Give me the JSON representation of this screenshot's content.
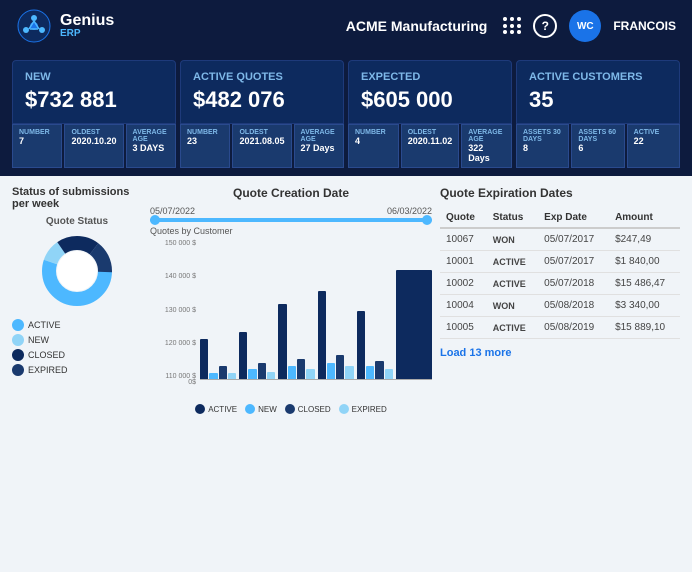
{
  "header": {
    "logo_text": "Genius",
    "logo_sub": "ERP",
    "company": "ACME Manufacturing",
    "user_initials": "WC",
    "user_name": "FRANCOIS",
    "help_label": "?",
    "grid_icon": "grid-icon"
  },
  "kpi_cards": [
    {
      "label": "New",
      "value": "$732 881"
    },
    {
      "label": "Active quotes",
      "value": "$482 076"
    },
    {
      "label": "Expected",
      "value": "$605 000"
    },
    {
      "label": "Active customers",
      "value": "35"
    }
  ],
  "stats": [
    {
      "items": [
        {
          "label": "NUMBER",
          "value": "7"
        },
        {
          "label": "OLDEST",
          "value": "2020.10.20"
        },
        {
          "label": "AVERAGE AGE",
          "value": "3 DAYS"
        }
      ]
    },
    {
      "items": [
        {
          "label": "NUMBER",
          "value": "23"
        },
        {
          "label": "OLDEST",
          "value": "2021.08.05"
        },
        {
          "label": "AVERAGE AGE",
          "value": "27 Days"
        }
      ]
    },
    {
      "items": [
        {
          "label": "NUMBER",
          "value": "4"
        },
        {
          "label": "OLDEST",
          "value": "2020.11.02"
        },
        {
          "label": "AVERAGE AGE",
          "value": "322 Days"
        }
      ]
    },
    {
      "items": [
        {
          "label": "ASSETS 30 days",
          "value": "8"
        },
        {
          "label": "ASSETS 60 days",
          "value": "6"
        },
        {
          "label": "ACTIVE",
          "value": "22"
        }
      ]
    }
  ],
  "status_title": "Status of submissions per week",
  "donut_label": "Quote Status",
  "donut_segments": [
    {
      "label": "ACTIVE",
      "color": "#4db8ff",
      "pct": 55
    },
    {
      "label": "NEW",
      "color": "#90d4f7",
      "pct": 10
    },
    {
      "label": "CLOSED",
      "color": "#0d2a5e",
      "pct": 20
    },
    {
      "label": "EXPIRED",
      "color": "#1a3a6e",
      "pct": 15
    }
  ],
  "chart_title": "Quote Creation Date",
  "date_start": "05/07/2022",
  "date_end": "06/03/2022",
  "chart_subtitle": "Quotes by Customer",
  "y_labels": [
    "150 000 $",
    "140 000 $",
    "130 000 $",
    "120 000 $",
    "110 000 $",
    "0$"
  ],
  "bar_groups": [
    {
      "active": 30,
      "new": 5,
      "closed": 10,
      "expired": 5
    },
    {
      "active": 35,
      "new": 8,
      "closed": 12,
      "expired": 6
    },
    {
      "active": 55,
      "new": 10,
      "closed": 15,
      "expired": 8
    },
    {
      "active": 65,
      "new": 12,
      "closed": 18,
      "expired": 10
    },
    {
      "active": 50,
      "new": 10,
      "closed": 14,
      "expired": 8
    },
    {
      "active": 80,
      "new": 0,
      "closed": 0,
      "expired": 0
    }
  ],
  "chart_legend": [
    {
      "label": "ACTIVE",
      "color": "#0d2a5e"
    },
    {
      "label": "NEW",
      "color": "#4db8ff"
    },
    {
      "label": "CLOSED",
      "color": "#1a3a6e"
    },
    {
      "label": "EXPIRED",
      "color": "#90d4f7"
    }
  ],
  "table_title": "Quote Expiration Dates",
  "table_headers": [
    "Quote",
    "Status",
    "Exp Date",
    "Amount"
  ],
  "table_rows": [
    {
      "quote": "10067",
      "status": "WON",
      "exp_date": "05/07/2017",
      "amount": "$247,49"
    },
    {
      "quote": "10001",
      "status": "ACTIVE",
      "exp_date": "05/07/2017",
      "amount": "$1 840,00"
    },
    {
      "quote": "10002",
      "status": "ACTIVE",
      "exp_date": "05/07/2018",
      "amount": "$15 486,47"
    },
    {
      "quote": "10004",
      "status": "WON",
      "exp_date": "05/08/2018",
      "amount": "$3 340,00"
    },
    {
      "quote": "10005",
      "status": "ACTIVE",
      "exp_date": "05/08/2019",
      "amount": "$15 889,10"
    }
  ],
  "load_more_label": "Load 13 more"
}
